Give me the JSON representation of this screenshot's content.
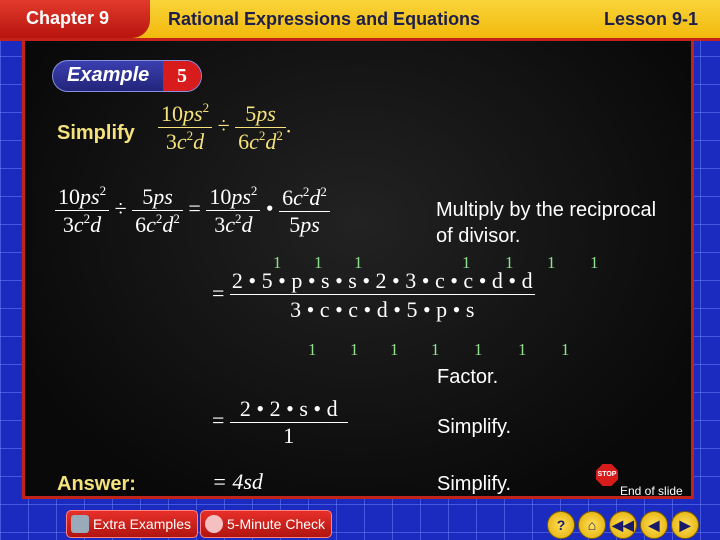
{
  "header": {
    "chapter": "Chapter 9",
    "title": "Rational Expressions and Equations",
    "lesson": "Lesson 9-1"
  },
  "example": {
    "label": "Example",
    "number": "5"
  },
  "problem": {
    "prompt": "Simplify",
    "frac1": {
      "num": "10ps²",
      "den": "3c²d"
    },
    "op": "÷",
    "frac2": {
      "num": "5ps",
      "den": "6c²d²"
    },
    "end": "."
  },
  "steps": [
    {
      "note": "Multiply by the reciprocal of divisor."
    },
    {
      "note": "Factor.",
      "numerator": "2 • 5 • p • s • s • 2 • 3 • c • c • d • d",
      "denominator": "3 • c • c • d • 5 • p • s",
      "cancel_mark": "1"
    },
    {
      "note": "Simplify.",
      "numerator": "2 • 2 • s • d",
      "denominator": "1"
    },
    {
      "note": "Simplify.",
      "result": "= 4sd"
    }
  ],
  "answer": {
    "label": "Answer:",
    "value": "= 4sd"
  },
  "footer": {
    "extra_examples": "Extra Examples",
    "five_minute_check": "5-Minute Check",
    "end_of_slide": "End of slide",
    "stop": "STOP",
    "nav": [
      "help-icon",
      "home-icon",
      "first-slide-icon",
      "previous-icon",
      "next-icon"
    ]
  }
}
